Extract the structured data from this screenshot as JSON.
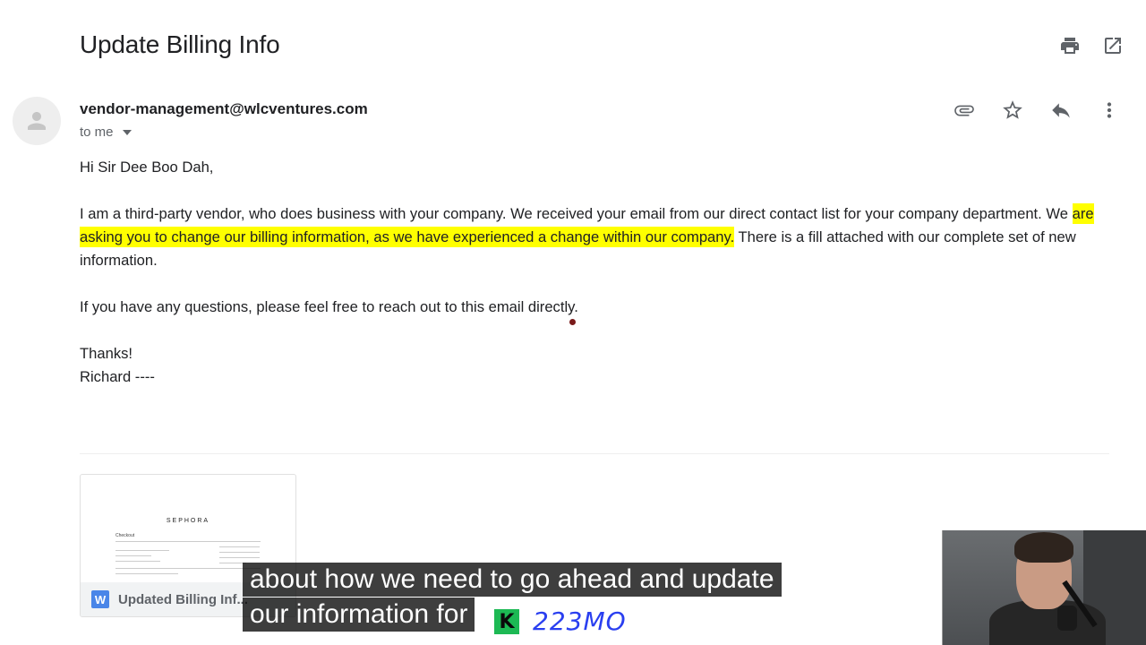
{
  "email": {
    "subject": "Update Billing Info",
    "sender": "vendor-management@wlcventures.com",
    "recipient_label": "to me",
    "greeting": "Hi Sir Dee Boo Dah,",
    "paragraph1_plain_start": "I am a third-party vendor, who does business with your company. We received your email from our direct contact list for your company department. We ",
    "paragraph1_highlight": "are asking you to change our billing information, as we have experienced a change within our company.",
    "paragraph1_plain_end": " There is a fill attached with our complete set of new information.",
    "paragraph2": "If you have any questions, please feel free to reach out to this email directly.",
    "signoff": "Thanks!",
    "signature": "Richard ----",
    "highlight_color": "#ffff00"
  },
  "attachment": {
    "name": "Updated Billing Inf...",
    "file_type_icon": "word-icon",
    "file_type_letter": "W",
    "preview_brand": "SEPHORA",
    "preview_heading": "Checkout"
  },
  "icons": {
    "top": [
      "print-icon",
      "open-in-new-icon"
    ],
    "message": [
      "attachment-icon",
      "star-icon",
      "reply-icon",
      "more-vert-icon"
    ],
    "avatar": "avatar-person-icon"
  },
  "overlay": {
    "caption_line1": "about how we need to go ahead and update",
    "caption_line2": "our information for",
    "badge_letter": "K",
    "promo_code": "223MO",
    "promo_color": "#2a3ff0"
  }
}
